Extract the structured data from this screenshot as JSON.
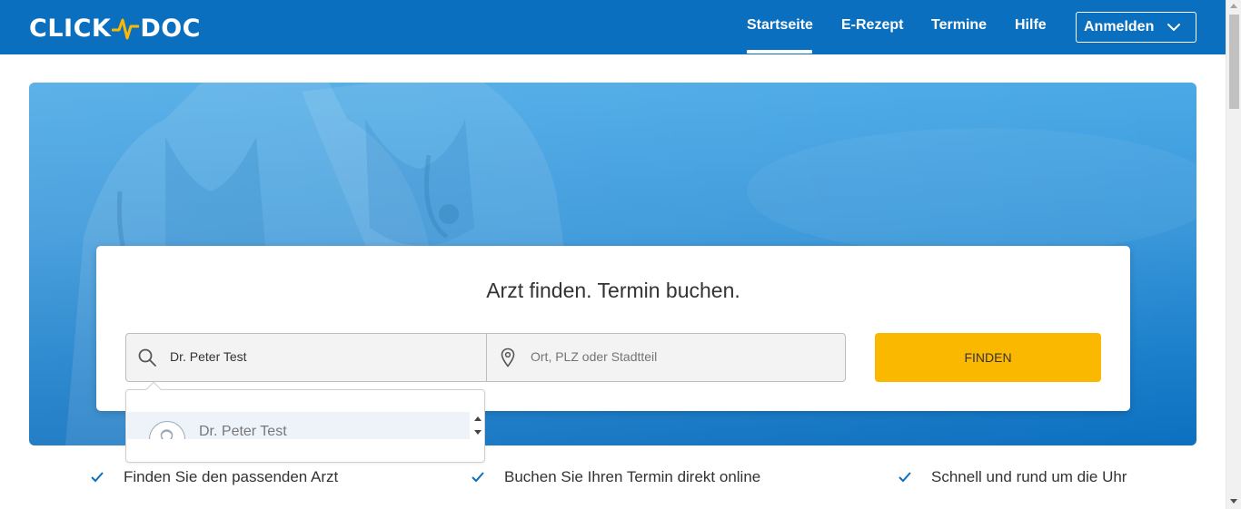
{
  "header": {
    "logo_left": "CLICK",
    "logo_right": "DOC",
    "nav": [
      {
        "label": "Startseite",
        "active": true
      },
      {
        "label": "E-Rezept",
        "active": false
      },
      {
        "label": "Termine",
        "active": false
      },
      {
        "label": "Hilfe",
        "active": false
      }
    ],
    "login_label": "Anmelden"
  },
  "search": {
    "title": "Arzt finden. Termin buchen.",
    "query_value": "Dr. Peter Test",
    "location_placeholder": "Ort, PLZ oder Stadtteil",
    "find_label": "FINDEN",
    "suggestions": [
      {
        "name": "Dr. Peter Test",
        "icon": "doctor-avatar-icon"
      }
    ]
  },
  "features": [
    "Finden Sie den passenden Arzt",
    "Buchen Sie Ihren Termin direkt online",
    "Schnell und rund um die Uhr"
  ],
  "colors": {
    "header_bg": "#0a6fbe",
    "accent_yellow": "#fbb800",
    "check_blue": "#0a6fbe",
    "logo_pulse": "#fbb800"
  }
}
